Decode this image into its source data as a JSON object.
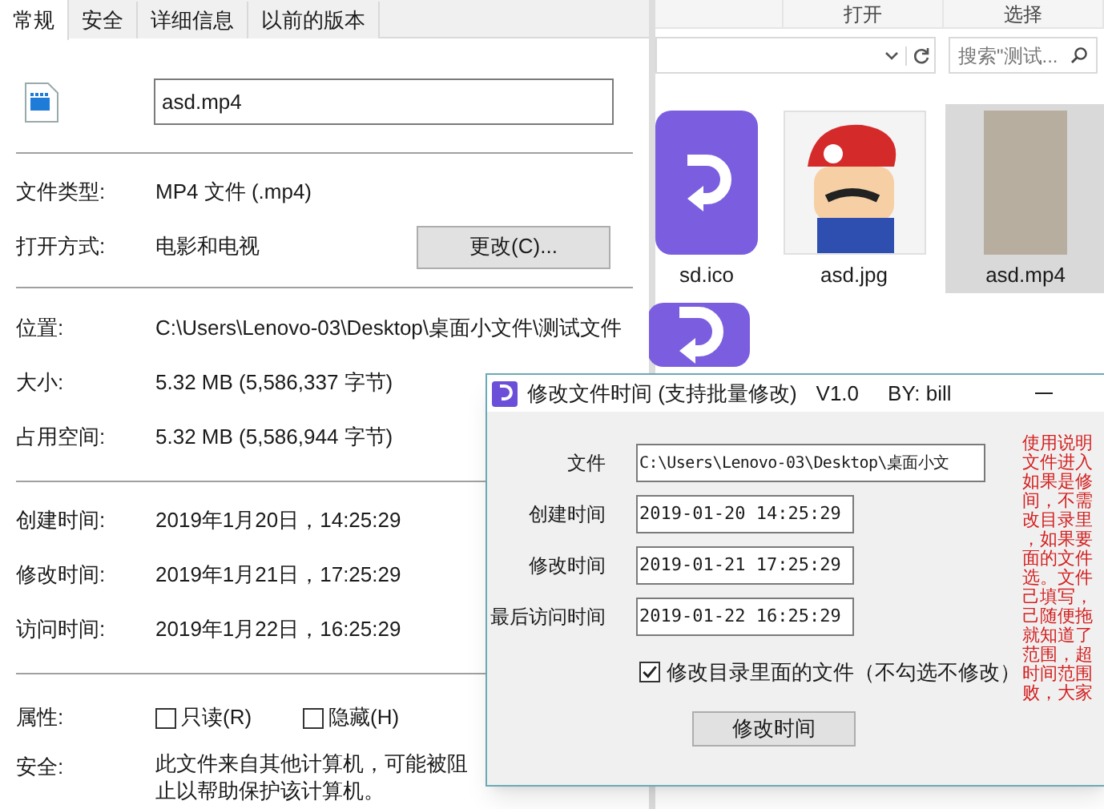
{
  "properties": {
    "tabs": [
      {
        "label": "常规",
        "selected": true
      },
      {
        "label": "安全",
        "selected": false
      },
      {
        "label": "详细信息",
        "selected": false
      },
      {
        "label": "以前的版本",
        "selected": false
      }
    ],
    "file_name": "asd.mp4",
    "rows_1": [
      {
        "label": "文件类型:",
        "value": "MP4 文件 (.mp4)"
      },
      {
        "label": "打开方式:",
        "value": "电影和电视",
        "button": "更改(C)..."
      }
    ],
    "rows_2": [
      {
        "label": "位置:",
        "value": "C:\\Users\\Lenovo-03\\Desktop\\桌面小文件\\测试文件"
      },
      {
        "label": "大小:",
        "value": "5.32 MB (5,586,337 字节)"
      },
      {
        "label": "占用空间:",
        "value": "5.32 MB (5,586,944 字节)"
      }
    ],
    "rows_3": [
      {
        "label": "创建时间:",
        "value": "2019年1月20日，14:25:29"
      },
      {
        "label": "修改时间:",
        "value": "2019年1月21日，17:25:29"
      },
      {
        "label": "访问时间:",
        "value": "2019年1月22日，16:25:29"
      }
    ],
    "attributes": {
      "label": "属性:",
      "options": [
        {
          "label": "只读(R)",
          "checked": false
        },
        {
          "label": "隐藏(H)",
          "checked": false
        }
      ]
    },
    "security": {
      "label": "安全:",
      "text": "此文件来自其他计算机，可能被阻止以帮助保护该计算机。"
    }
  },
  "explorer": {
    "ribbon": [
      "打开",
      "选择"
    ],
    "search": {
      "placeholder": "搜索\"测试..."
    },
    "files": [
      {
        "name": "sd.ico",
        "kind": "app",
        "selected": false
      },
      {
        "name": "asd.jpg",
        "kind": "picture",
        "selected": false
      },
      {
        "name": "asd.mp4",
        "kind": "video",
        "selected": true
      },
      {
        "kind": "app",
        "selected": false
      }
    ]
  },
  "tool": {
    "title": "修改文件时间 (支持批量修改)",
    "version": "V1.0",
    "author": "BY: bill",
    "fields": [
      {
        "label": "文件",
        "value": "C:\\Users\\Lenovo-03\\Desktop\\桌面小文"
      },
      {
        "label": "创建时间",
        "value": "2019-01-20 14:25:29"
      },
      {
        "label": "修改时间",
        "value": "2019-01-21 17:25:29"
      },
      {
        "label": "最后访问时间",
        "value": "2019-01-22 16:25:29"
      }
    ],
    "include_subfiles": {
      "label": "修改目录里面的文件（不勾选不修改）",
      "checked": true
    },
    "button": "修改时间",
    "instructions": [
      "使用说明",
      "文件进入",
      "如果是修",
      "间，不需",
      "改目录里",
      "，如果要",
      "面的文件",
      "选。文件",
      "己填写，",
      "己随便拖",
      "就知道了",
      "范围，超",
      "时间范围",
      "败，大家"
    ]
  }
}
